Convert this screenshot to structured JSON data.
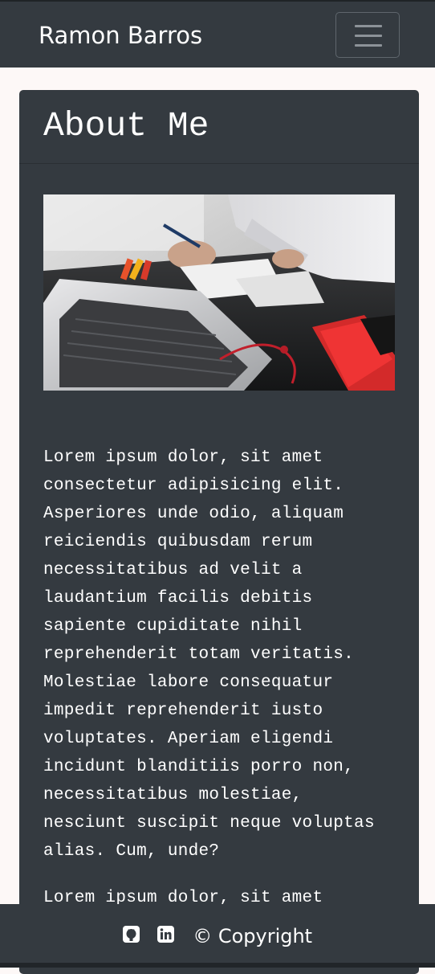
{
  "navbar": {
    "brand": "Ramon Barros",
    "toggler_icon": "hamburger-icon"
  },
  "card": {
    "title": "About Me",
    "image_icon": "laptop-desk-photo",
    "paragraphs": [
      "Lorem ipsum dolor, sit amet consectetur adipisicing elit. Asperiores unde odio, aliquam reiciendis quibusdam rerum necessitatibus ad velit a laudantium facilis debitis sapiente cupiditate nihil reprehenderit totam veritatis. Molestiae labore consequatur impedit reprehenderit iusto voluptates. Aperiam eligendi incidunt blanditiis porro non, necessitatibus molestiae, nesciunt suscipit neque voluptas alias. Cum, unde?",
      "Lorem ipsum dolor, sit amet"
    ]
  },
  "footer": {
    "github_icon": "github-icon",
    "linkedin_icon": "linkedin-icon",
    "copyright": "© Copyright"
  },
  "colors": {
    "dark": "#343a40",
    "page_background": "#fdf8f7",
    "text": "#ffffff"
  }
}
